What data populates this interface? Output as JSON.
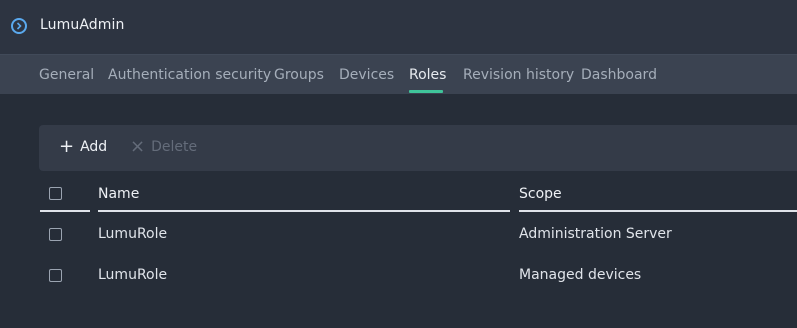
{
  "app": {
    "icon": "chevron-right-circle-icon",
    "title": "LumuAdmin"
  },
  "tabs": [
    {
      "label": "General"
    },
    {
      "label": "Authentication security"
    },
    {
      "label": "Groups"
    },
    {
      "label": "Devices"
    },
    {
      "label": "Roles",
      "active": true
    },
    {
      "label": "Revision history"
    },
    {
      "label": "Dashboard"
    }
  ],
  "toolbar": {
    "add_icon": "plus-icon",
    "add_label": "Add",
    "delete_icon": "close-icon",
    "delete_label": "Delete",
    "delete_disabled": true
  },
  "table": {
    "columns": [
      "Name",
      "Scope"
    ],
    "rows": [
      {
        "name": "LumuRole",
        "scope": "Administration Server"
      },
      {
        "name": "LumuRole",
        "scope": "Managed devices"
      }
    ]
  },
  "colors": {
    "accent": "#3fc49a",
    "icon_blue": "#5aa9ee"
  }
}
